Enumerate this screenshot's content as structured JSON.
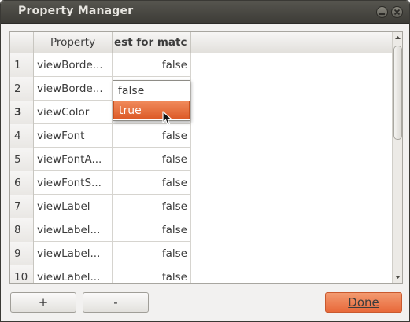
{
  "window": {
    "title": "Property Manager"
  },
  "table": {
    "columns": {
      "property": "Property",
      "test": "est for matc"
    },
    "rows": [
      {
        "num": "1",
        "property": "viewBorde...",
        "value": "false"
      },
      {
        "num": "2",
        "property": "viewBorde...",
        "value": ""
      },
      {
        "num": "3",
        "property": "viewColor",
        "value": ""
      },
      {
        "num": "4",
        "property": "viewFont",
        "value": "false"
      },
      {
        "num": "5",
        "property": "viewFontA...",
        "value": "false"
      },
      {
        "num": "6",
        "property": "viewFontS...",
        "value": "false"
      },
      {
        "num": "7",
        "property": "viewLabel",
        "value": "false"
      },
      {
        "num": "8",
        "property": "viewLabel...",
        "value": "false"
      },
      {
        "num": "9",
        "property": "viewLabel...",
        "value": "false"
      },
      {
        "num": "10",
        "property": "viewLabel...",
        "value": "false"
      }
    ]
  },
  "dropdown": {
    "options": [
      "false",
      "true"
    ],
    "selected": "true"
  },
  "buttons": {
    "add": "+",
    "remove": "-",
    "done": "Done"
  },
  "colors": {
    "accent": "#e8693a",
    "titlebar": "#3d3c37"
  }
}
